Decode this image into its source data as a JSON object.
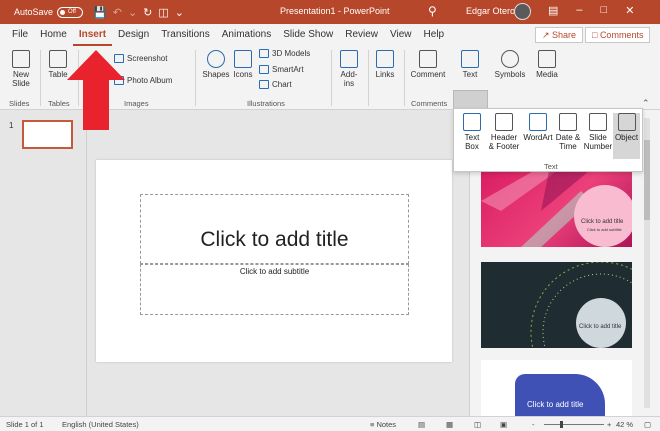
{
  "titlebar": {
    "autosave_label": "AutoSave",
    "autosave_state": "Off",
    "app_title": "Presentation1 - PowerPoint",
    "user_name": "Edgar Otero"
  },
  "tabs": [
    "File",
    "Home",
    "Insert",
    "Design",
    "Transitions",
    "Animations",
    "Slide Show",
    "Review",
    "View",
    "Help"
  ],
  "active_tab": "Insert",
  "share_label": "Share",
  "comments_label": "Comments",
  "ribbon": {
    "new_slide": "New Slide",
    "table": "Table",
    "screenshot": "Screenshot",
    "photo_album": "Photo Album",
    "shapes": "Shapes",
    "icons": "Icons",
    "models_3d": "3D Models",
    "smartart": "SmartArt",
    "chart": "Chart",
    "addins": "Add-ins",
    "links": "Links",
    "comment": "Comment",
    "text": "Text",
    "symbols": "Symbols",
    "media": "Media",
    "groups": {
      "slides": "Slides",
      "tables": "Tables",
      "images": "Images",
      "illustrations": "Illustrations",
      "comments": "Comments"
    }
  },
  "text_dropdown": {
    "items": [
      {
        "line1": "Text",
        "line2": "Box"
      },
      {
        "line1": "Header",
        "line2": "& Footer"
      },
      {
        "line1": "WordArt",
        "line2": ""
      },
      {
        "line1": "Date &",
        "line2": "Time"
      },
      {
        "line1": "Slide",
        "line2": "Number"
      },
      {
        "line1": "Object",
        "line2": ""
      }
    ],
    "group_label": "Text"
  },
  "slides_panel": {
    "slide_number": "1"
  },
  "slide": {
    "title_placeholder": "Click to add title",
    "subtitle_placeholder": "Click to add subtitle"
  },
  "designer": {
    "thumb_title": "Click to add title",
    "thumb_sub": "Click to add subtitle"
  },
  "statusbar": {
    "slide_info": "Slide 1 of 1",
    "language": "English (United States)",
    "notes": "Notes",
    "zoom_minus": "-",
    "zoom_plus": "+",
    "zoom": "42 %"
  },
  "colors": {
    "accent": "#b7472a",
    "arrow": "#e8232d"
  }
}
